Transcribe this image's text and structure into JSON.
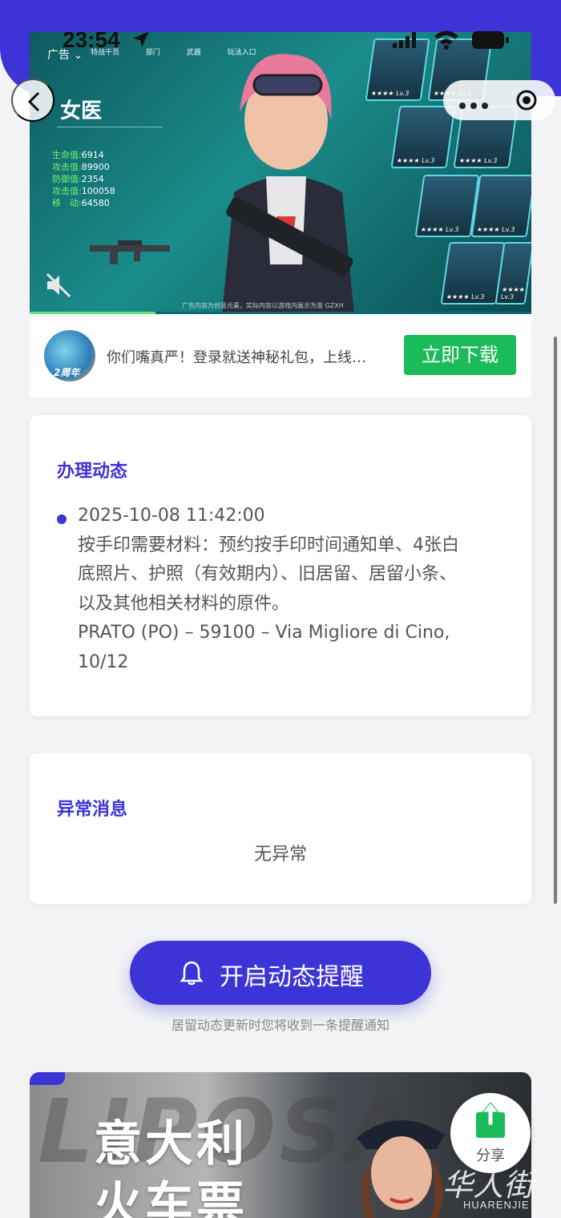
{
  "status_bar": {
    "time": "23:54"
  },
  "ad": {
    "tag": "广告",
    "tabs": [
      "特战干员",
      "部门",
      "武器",
      "玩法入口"
    ],
    "hero_title": "女医",
    "stats": [
      {
        "label": "生命值:",
        "value": "6914"
      },
      {
        "label": "攻击值:",
        "value": "89900"
      },
      {
        "label": "防御值:",
        "value": "2354"
      },
      {
        "label": "攻击值:",
        "value": "100058"
      },
      {
        "label": "移　动:",
        "value": "64580"
      }
    ],
    "card_level": "Lv.3",
    "footer": "广告内容为创意元素，实际内容以游戏内展示为准 GZXH",
    "progress": 0.25,
    "logo_badge": "2周年",
    "description": "你们嘴真严！登录就送神秘礼包，上线…",
    "download_label": "立即下载"
  },
  "progress_card": {
    "title": "办理动态",
    "entry": {
      "datetime": "2025-10-08 11:42:00",
      "lines": [
        "按手印需要材料：预约按手印时间通知单、4张白",
        "底照片、护照（有效期内）、旧居留、居留小条、",
        "以及其他相关材料的原件。",
        "PRATO (PO) – 59100 – Via Migliore di Cino,",
        "10/12"
      ]
    }
  },
  "anomaly_card": {
    "title": "异常消息",
    "message": "无异常"
  },
  "reminder": {
    "button_label": "开启动态提醒",
    "hint": "居留动态更新时您将收到一条提醒通知"
  },
  "bottom_banner": {
    "title_line1": "意大利",
    "title_line2": "火车票"
  },
  "share": {
    "label": "分享"
  },
  "watermark": {
    "cn": "华人街",
    "en": "HUARENJIE"
  },
  "colors": {
    "accent": "#3c34d6",
    "download_green": "#1cbb5a"
  }
}
